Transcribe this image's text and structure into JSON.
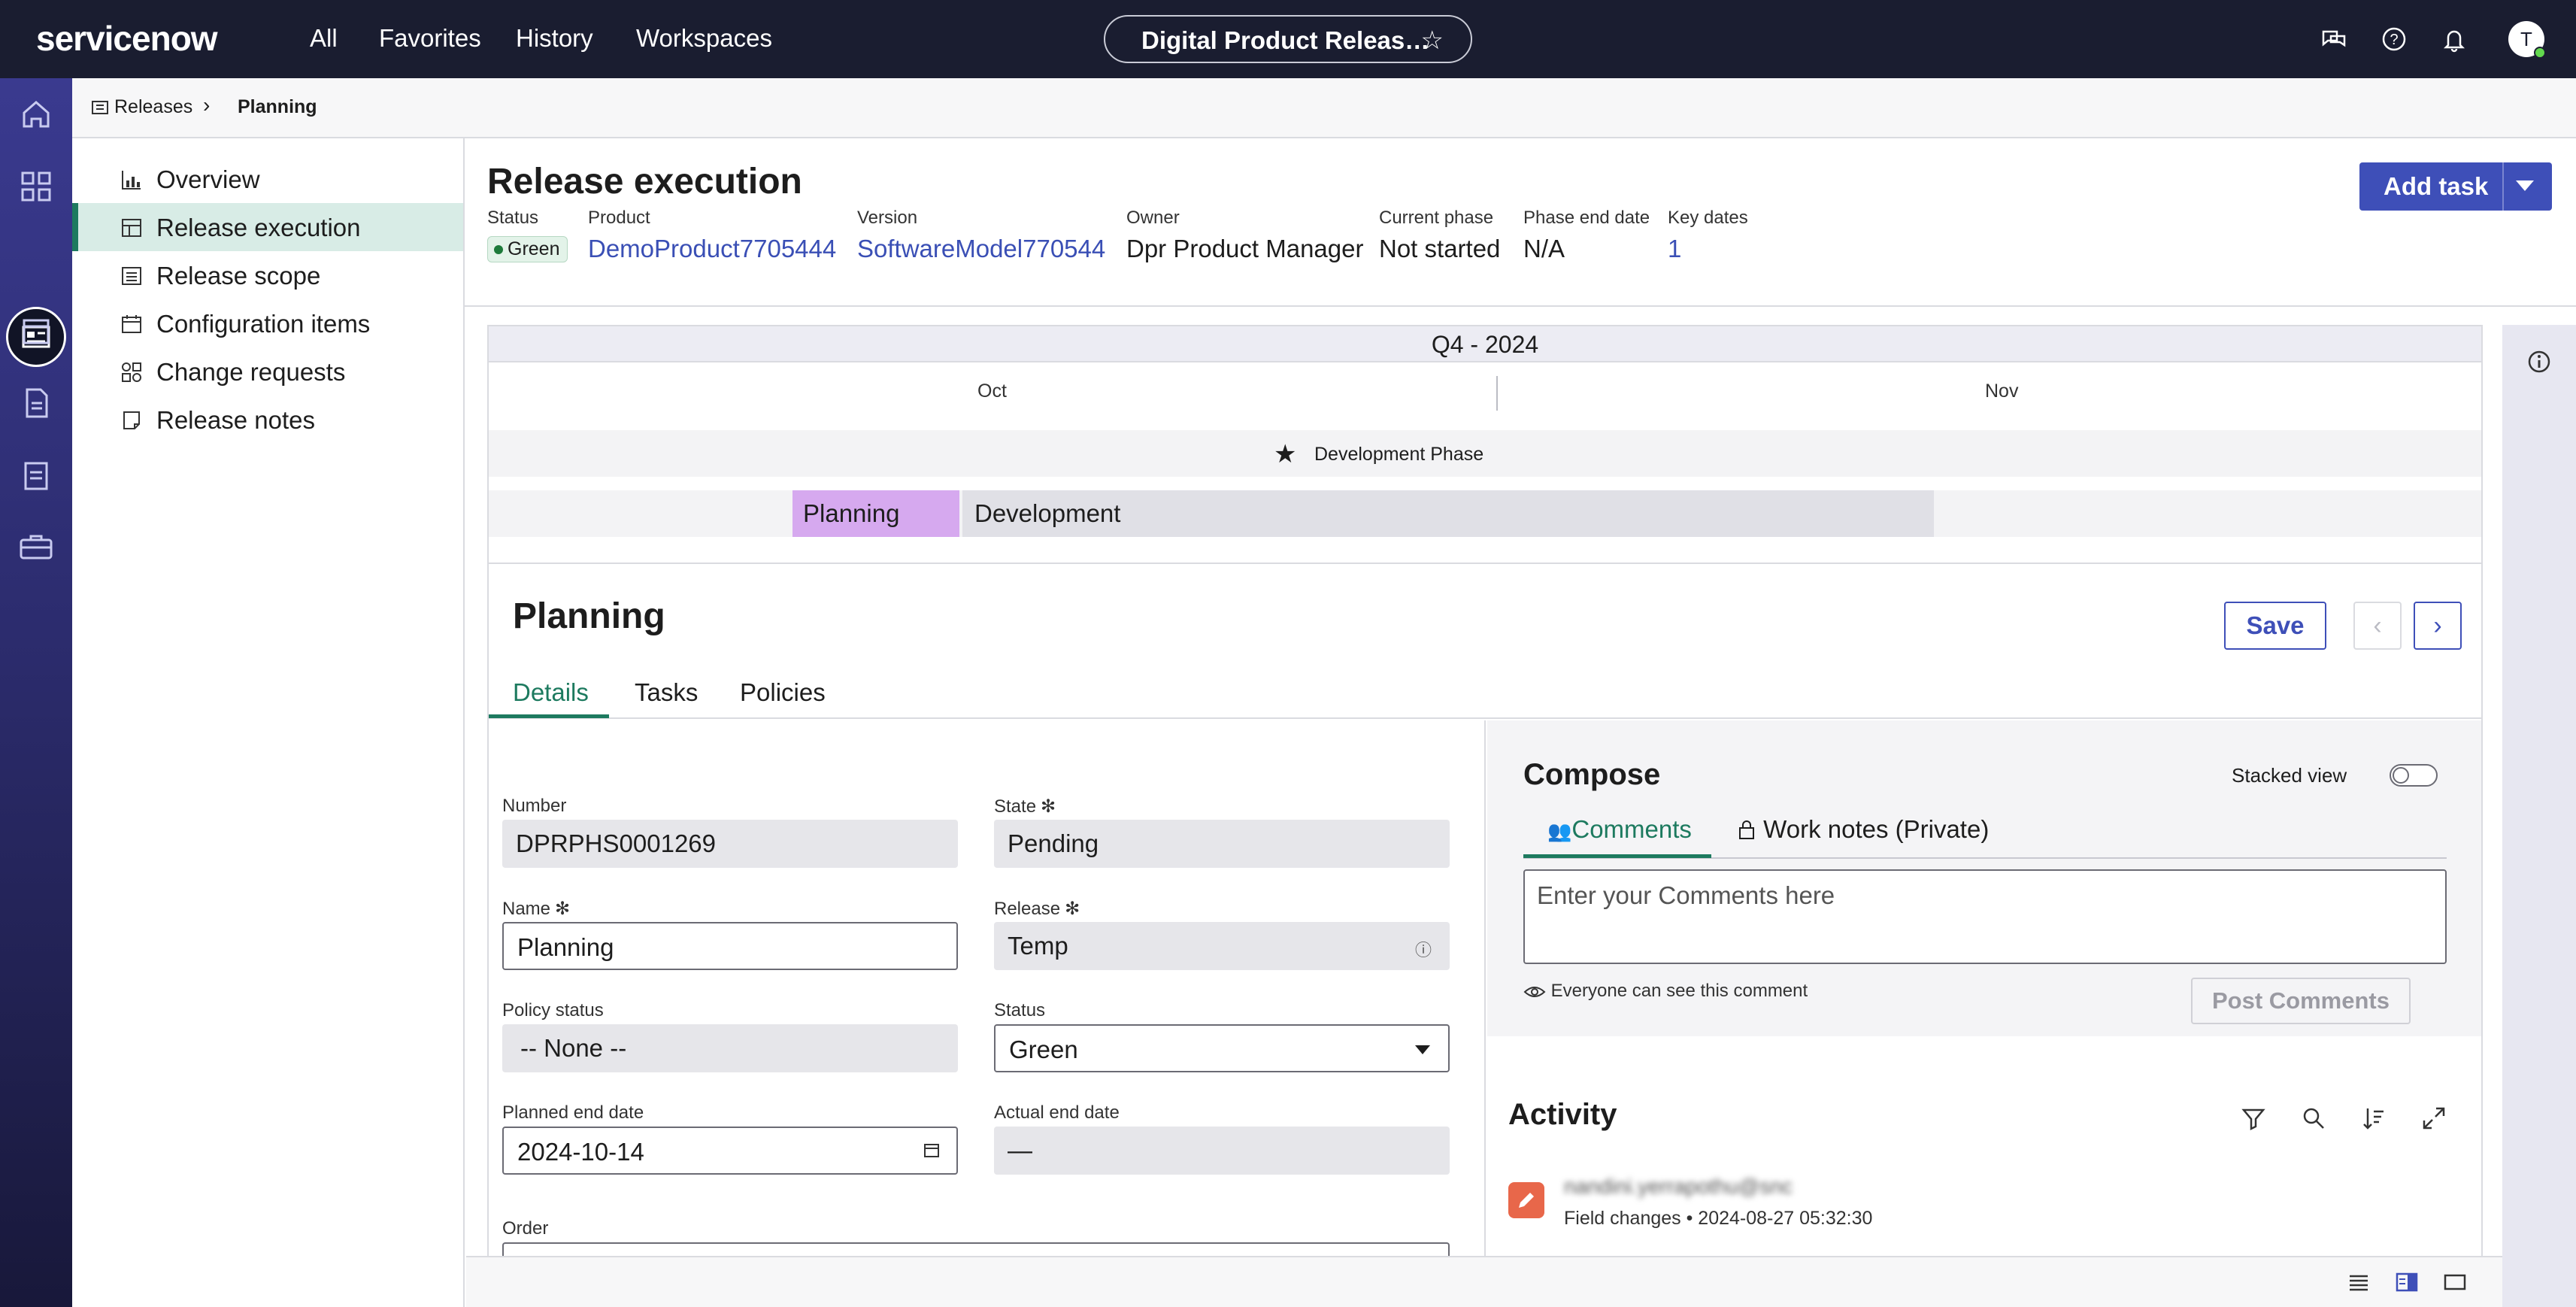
{
  "topbar": {
    "logo_text": "servicenow",
    "nav": [
      "All",
      "Favorites",
      "History",
      "Workspaces"
    ],
    "workspace_title": "Digital Product Releas…",
    "avatar_initial": "T"
  },
  "breadcrumb": {
    "root": "Releases",
    "current": "Planning"
  },
  "sidenav": {
    "items": [
      {
        "label": "Overview",
        "icon": "chart-icon"
      },
      {
        "label": "Release execution",
        "icon": "table-icon",
        "active": true
      },
      {
        "label": "Release scope",
        "icon": "list-icon"
      },
      {
        "label": "Configuration items",
        "icon": "calendar-icon"
      },
      {
        "label": "Change requests",
        "icon": "grid-icon"
      },
      {
        "label": "Release notes",
        "icon": "note-icon"
      }
    ]
  },
  "header": {
    "title": "Release execution",
    "fields": [
      {
        "key": "Status",
        "value": "Green"
      },
      {
        "key": "Product",
        "value": "DemoProduct7705444"
      },
      {
        "key": "Version",
        "value": "SoftwareModel770544"
      },
      {
        "key": "Owner",
        "value": "Dpr Product Manager"
      },
      {
        "key": "Current phase",
        "value": "Not started"
      },
      {
        "key": "Phase end date",
        "value": "N/A"
      },
      {
        "key": "Key dates",
        "value": "1"
      }
    ],
    "add_task_label": "Add task"
  },
  "timeline": {
    "quarter": "Q4 - 2024",
    "months": [
      "Oct",
      "Nov"
    ],
    "milestone": "Development Phase",
    "phases": [
      "Planning",
      "Development"
    ]
  },
  "card": {
    "title": "Planning",
    "save_label": "Save",
    "tabs": [
      "Details",
      "Tasks",
      "Policies"
    ],
    "form": {
      "number_label": "Number",
      "number_value": "DPRPHS0001269",
      "state_label": "State",
      "state_value": "Pending",
      "name_label": "Name",
      "name_value": "Planning",
      "release_label": "Release",
      "release_value": "Temp",
      "policy_label": "Policy status",
      "policy_value": "-- None --",
      "status_label": "Status",
      "status_value": "Green",
      "planned_label": "Planned end date",
      "planned_value": "2024-10-14",
      "actual_label": "Actual end date",
      "actual_value": "—",
      "order_label": "Order"
    }
  },
  "compose": {
    "title": "Compose",
    "stacked_label": "Stacked view",
    "tab_comments": "Comments",
    "tab_worknotes": "Work notes (Private)",
    "placeholder": "Enter your Comments here",
    "visibility": "Everyone can see this comment",
    "post_label": "Post Comments"
  },
  "activity": {
    "title": "Activity",
    "entry_name": "nandini.yerrapothu@snc",
    "entry_meta": "Field changes • 2024-08-27 05:32:30"
  },
  "colors": {
    "topbar_bg": "#1a1d30",
    "accent": "#3e4fb8",
    "active_green": "#1d7a5f",
    "planning_bar": "#d6a9ef"
  }
}
